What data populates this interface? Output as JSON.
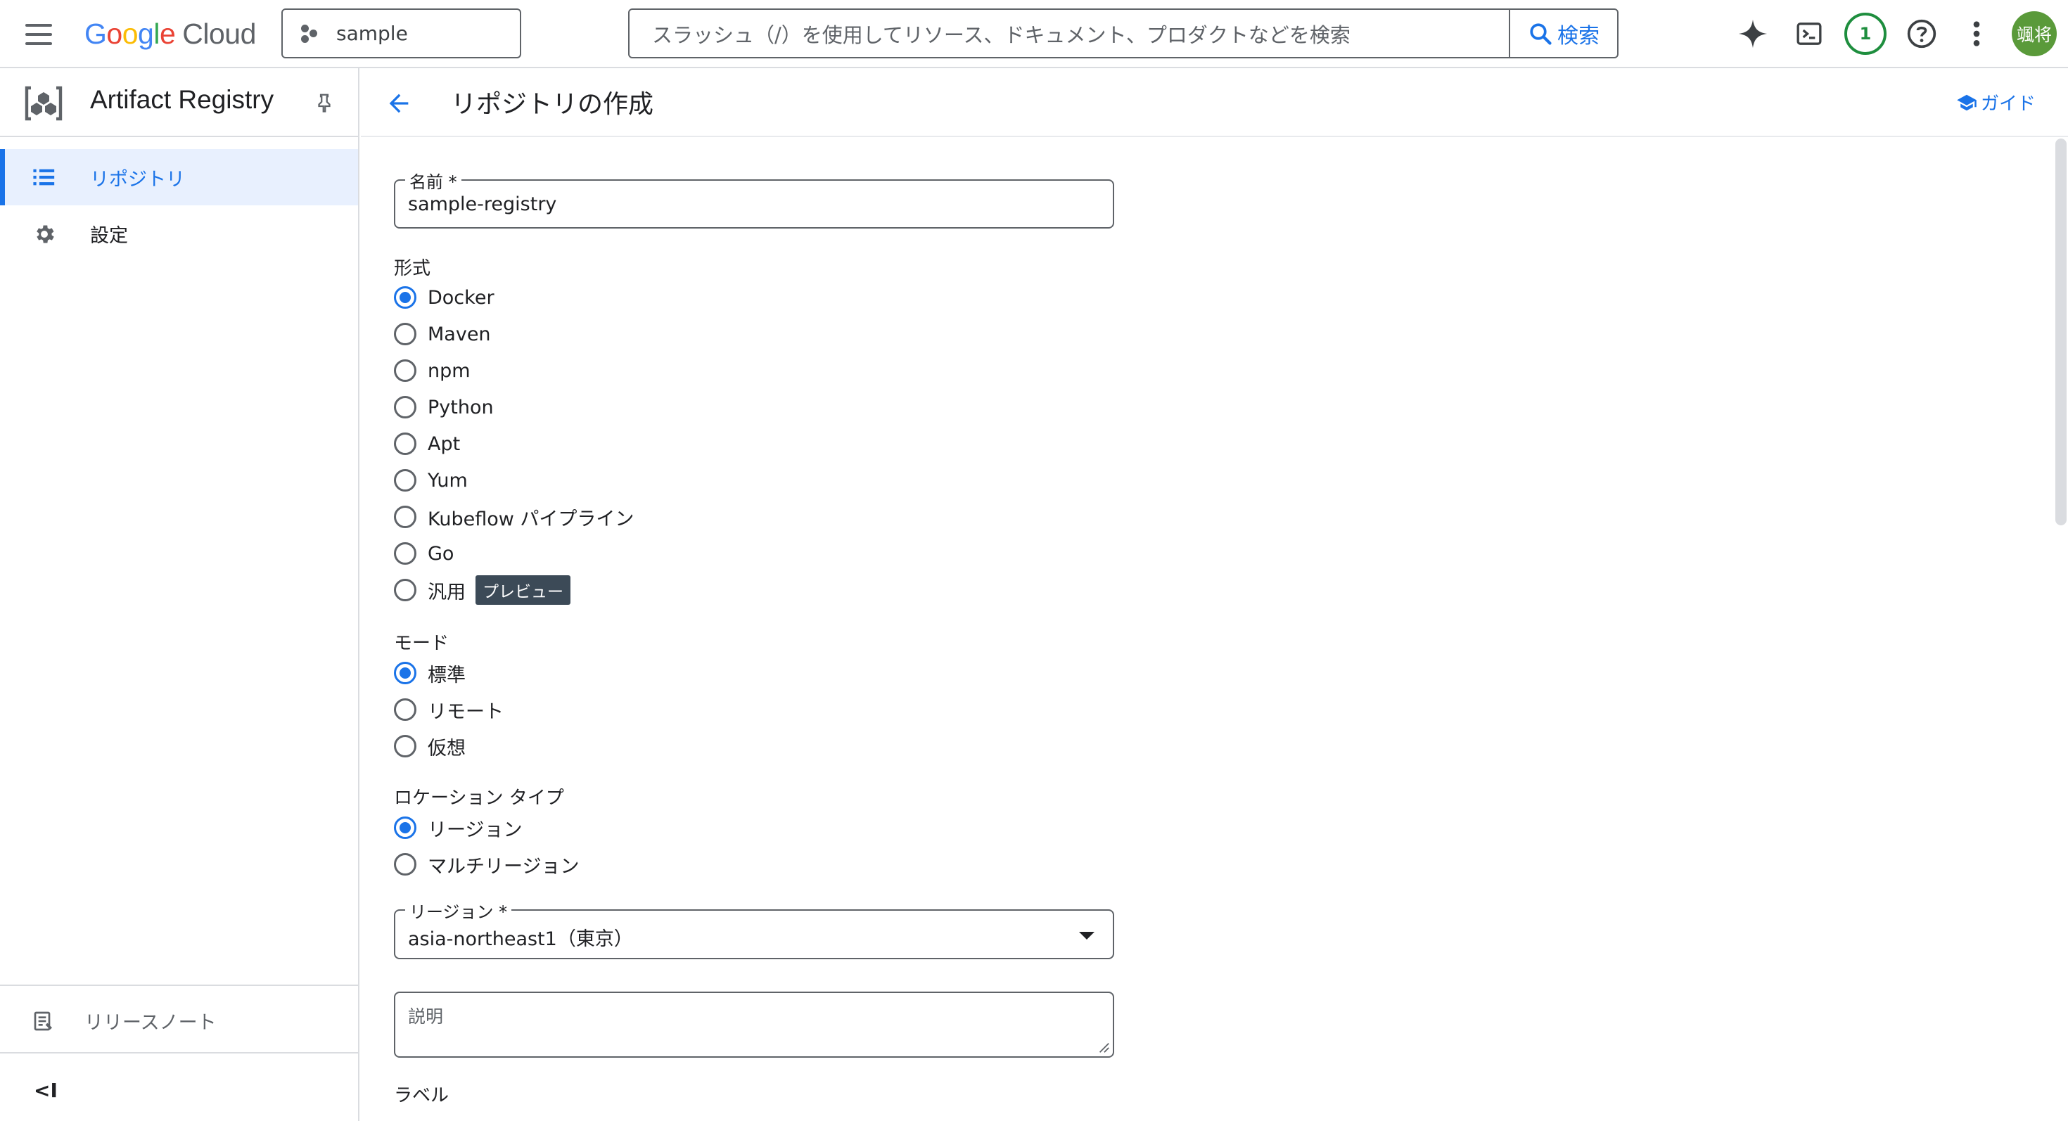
{
  "header": {
    "logo_google": "Google",
    "logo_cloud": "Cloud",
    "project": "sample",
    "search_placeholder": "スラッシュ（/）を使用してリソース、ドキュメント、プロダクトなどを検索",
    "search_button": "検索",
    "notification_count": "1",
    "avatar_text": "颯将",
    "icons": [
      "menu-icon",
      "gemini-spark-icon",
      "cloud-shell-icon",
      "help-icon",
      "more-vert-icon"
    ]
  },
  "sidebar": {
    "product_name": "Artifact Registry",
    "items": [
      {
        "label": "リポジトリ",
        "icon": "list-icon",
        "active": true
      },
      {
        "label": "設定",
        "icon": "gear-icon",
        "active": false
      }
    ],
    "release_notes": "リリースノート",
    "collapse_label": "<I"
  },
  "page": {
    "title": "リポジトリの作成",
    "guide_label": "ガイド",
    "name_field": {
      "label": "名前 *",
      "value": "sample-registry"
    },
    "format": {
      "label": "形式",
      "options": [
        "Docker",
        "Maven",
        "npm",
        "Python",
        "Apt",
        "Yum",
        "Kubeflow パイプライン",
        "Go",
        "汎用"
      ],
      "selected": "Docker",
      "preview_badge": "プレビュー"
    },
    "mode": {
      "label": "モード",
      "options": [
        "標準",
        "リモート",
        "仮想"
      ],
      "selected": "標準"
    },
    "location_type": {
      "label": "ロケーション タイプ",
      "options": [
        "リージョン",
        "マルチリージョン"
      ],
      "selected": "リージョン"
    },
    "region_field": {
      "label": "リージョン *",
      "value": "asia-northeast1（東京）"
    },
    "description_field": {
      "placeholder": "説明"
    },
    "labels_label": "ラベル"
  },
  "colors": {
    "accent": "#1a73e8",
    "active_nav_bg": "#e8f0fe",
    "notification": "#1e8e3e",
    "avatar_bg": "#5a9a3a",
    "preview_badge_bg": "#3c4a57"
  }
}
